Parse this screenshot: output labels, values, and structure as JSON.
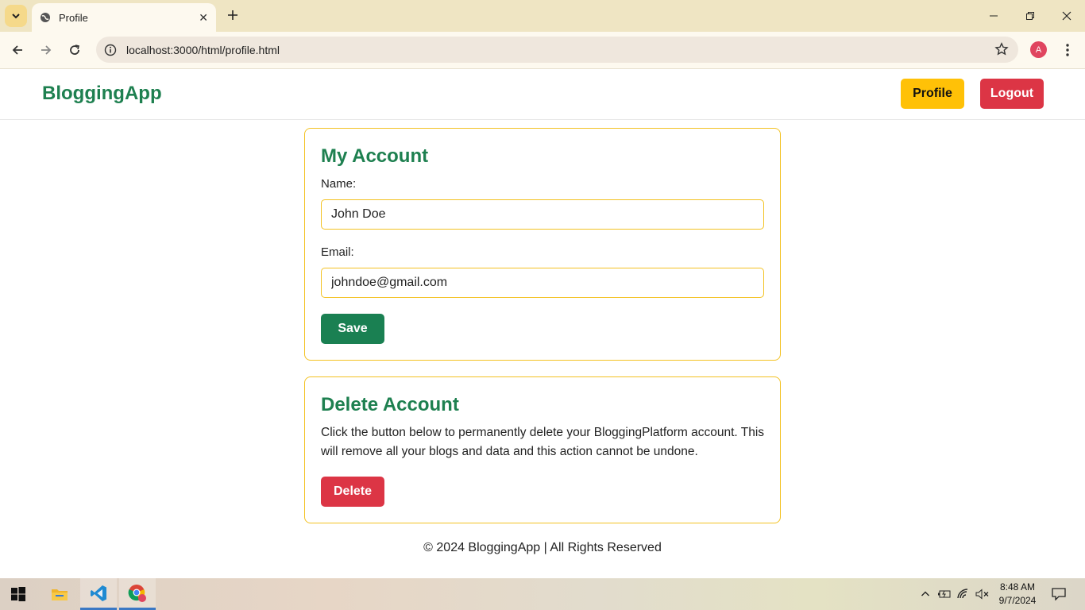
{
  "browser": {
    "tab_title": "Profile",
    "url": "localhost:3000/html/profile.html",
    "profile_initial": "A"
  },
  "site": {
    "brand": "BloggingApp",
    "nav": {
      "profile_label": "Profile",
      "logout_label": "Logout"
    }
  },
  "account": {
    "title": "My Account",
    "name_label": "Name:",
    "name_value": "John Doe",
    "email_label": "Email:",
    "email_value": "johndoe@gmail.com",
    "save_label": "Save"
  },
  "delete_account": {
    "title": "Delete Account",
    "description": "Click the button below to permanently delete your BloggingPlatform account. This will remove all your blogs and data and this action cannot be undone.",
    "delete_label": "Delete"
  },
  "footer": {
    "text": "© 2024 BloggingApp | All Rights Reserved"
  },
  "taskbar": {
    "time": "8:48 AM",
    "date": "9/7/2024",
    "apps": [
      "windows-start-icon",
      "file-explorer-icon",
      "vscode-icon",
      "chrome-icon"
    ]
  },
  "colors": {
    "brand_green": "#1e8050",
    "accent_yellow": "#ffc107",
    "danger_red": "#dc3545",
    "card_border": "#f3c222"
  }
}
